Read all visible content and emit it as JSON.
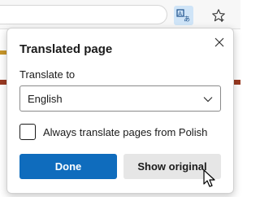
{
  "toolbar": {
    "translate_icon": "translate-icon",
    "favorite_icon": "star-icon",
    "translate_active_color": "#cfe4f7"
  },
  "popup": {
    "title": "Translated page",
    "close_icon": "close-icon",
    "translate_to_label": "Translate to",
    "language_selected": "English",
    "always_translate_label": "Always translate pages from Polish",
    "always_translate_checked": false,
    "done_label": "Done",
    "show_original_label": "Show original"
  },
  "colors": {
    "primary": "#0f6cbd",
    "secondary_button": "#e6e6e6"
  }
}
